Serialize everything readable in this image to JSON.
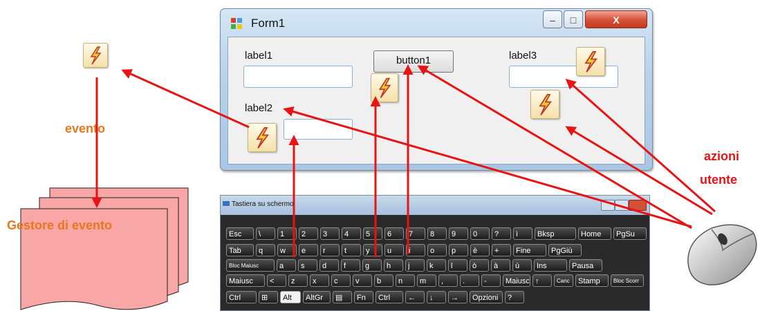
{
  "form": {
    "title": "Form1",
    "minimize": "–",
    "maximize": "□",
    "close": "X",
    "label1": "label1",
    "label2": "label2",
    "label3": "label3",
    "button1": "button1"
  },
  "keyboard": {
    "title": "Tastiera su schermo",
    "rows": [
      [
        "Esc",
        "\\",
        "1",
        "2",
        "3",
        "4",
        "5",
        "6",
        "7",
        "8",
        "9",
        "0",
        "?",
        "ì",
        "Bksp",
        "Home",
        "PgSu"
      ],
      [
        "Tab",
        "q",
        "w",
        "e",
        "r",
        "t",
        "y",
        "u",
        "i",
        "o",
        "p",
        "è",
        "+",
        "Fine",
        "PgGiù"
      ],
      [
        "Bloc Maiusc",
        "a",
        "s",
        "d",
        "f",
        "g",
        "h",
        "j",
        "k",
        "l",
        "ò",
        "à",
        "ù",
        "Ins",
        "Pausa"
      ],
      [
        "Maiusc",
        "<",
        "z",
        "x",
        "c",
        "v",
        "b",
        "n",
        "m",
        ",",
        ".",
        "-",
        "Maiusc",
        "↑",
        "Canc",
        "Stamp",
        "Bloc Scorr"
      ],
      [
        "Ctrl",
        "⊞",
        "Alt",
        "AltGr",
        "▤",
        "Fn",
        "Ctrl",
        "←",
        "↓",
        "→",
        "Opzioni",
        "?"
      ]
    ]
  },
  "labels": {
    "event": "evento",
    "handler": "Gestore di evento",
    "user_actions_1": "azioni",
    "user_actions_2": "utente"
  },
  "colors": {
    "arrow": "#e81313",
    "event_text": "#e8771e",
    "actions_text": "#e81313",
    "document_fill": "#f8a6a6"
  },
  "icons": {
    "event": "lightning-bolt-icon",
    "mouse": "mouse-icon",
    "form_icon": "windows-form-icon"
  }
}
